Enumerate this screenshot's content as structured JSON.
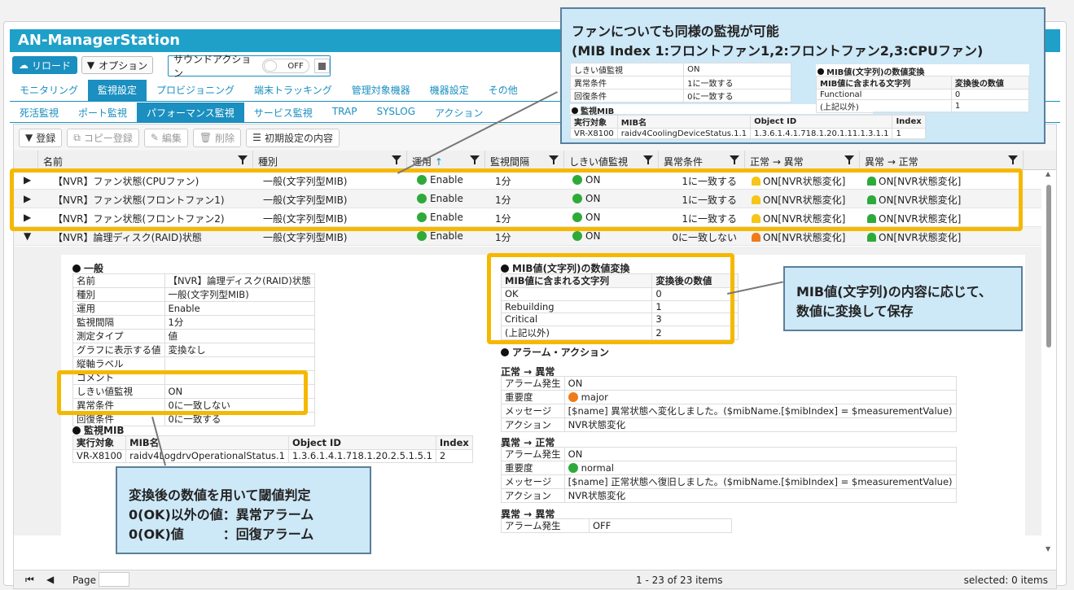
{
  "app": {
    "title": "AN-ManagerStation"
  },
  "toolbar": {
    "reload": "リロード",
    "option": "オプション",
    "sound_action": "サウンドアクション",
    "sound_state": "OFF"
  },
  "main_tabs": [
    "モニタリング",
    "監視設定",
    "プロビジョニング",
    "端末トラッキング",
    "管理対象機器",
    "機器設定",
    "その他"
  ],
  "sub_tabs": [
    "死活監視",
    "ポート監視",
    "パフォーマンス監視",
    "サービス監視",
    "TRAP",
    "SYSLOG",
    "アクション"
  ],
  "grid_toolbar": {
    "register": "登録",
    "copy_register": "コピー登録",
    "edit": "編集",
    "delete": "削除",
    "initial_settings": "初期設定の内容"
  },
  "columns": [
    "名前",
    "種別",
    "運用",
    "監視間隔",
    "しきい値監視",
    "異常条件",
    "正常 → 異常",
    "異常 → 正常"
  ],
  "rows": [
    {
      "name": "【NVR】ファン状態(CPUファン)",
      "type": "一般(文字列型MIB)",
      "status": "Enable",
      "interval": "1分",
      "threshold": "ON",
      "condition": "1に一致する",
      "to_abnormal": "ON[NVR状態変化]",
      "to_normal": "ON[NVR状態変化]"
    },
    {
      "name": "【NVR】ファン状態(フロントファン1)",
      "type": "一般(文字列型MIB)",
      "status": "Enable",
      "interval": "1分",
      "threshold": "ON",
      "condition": "1に一致する",
      "to_abnormal": "ON[NVR状態変化]",
      "to_normal": "ON[NVR状態変化]"
    },
    {
      "name": "【NVR】ファン状態(フロントファン2)",
      "type": "一般(文字列型MIB)",
      "status": "Enable",
      "interval": "1分",
      "threshold": "ON",
      "condition": "1に一致する",
      "to_abnormal": "ON[NVR状態変化]",
      "to_normal": "ON[NVR状態変化]"
    },
    {
      "name": "【NVR】論理ディスク(RAID)状態",
      "type": "一般(文字列型MIB)",
      "status": "Enable",
      "interval": "1分",
      "threshold": "ON",
      "condition": "0に一致しない",
      "to_abnormal": "ON[NVR状態変化]",
      "to_normal": "ON[NVR状態変化]"
    }
  ],
  "detail": {
    "general_title": "一般",
    "general": [
      [
        "名前",
        "【NVR】論理ディスク(RAID)状態"
      ],
      [
        "種別",
        "一般(文字列型MIB)"
      ],
      [
        "運用",
        "Enable"
      ],
      [
        "監視間隔",
        "1分"
      ],
      [
        "測定タイプ",
        "値"
      ],
      [
        "グラフに表示する値",
        "変換なし"
      ],
      [
        "縦軸ラベル",
        ""
      ],
      [
        "コメント",
        ""
      ],
      [
        "しきい値監視",
        "ON"
      ],
      [
        "異常条件",
        "0に一致しない"
      ],
      [
        "回復条件",
        "0に一致する"
      ]
    ],
    "mib_title": "監視MIB",
    "mib_headers": [
      "実行対象",
      "MIB名",
      "Object ID",
      "Index"
    ],
    "mib_row": [
      "VR-X8100",
      "raidv4LogdrvOperationalStatus.1",
      "1.3.6.1.4.1.718.1.20.2.5.1.5.1",
      "2"
    ],
    "conv_title": "MIB値(文字列)の数値変換",
    "conv_headers": [
      "MIB値に含まれる文字列",
      "変換後の数値"
    ],
    "conv_rows": [
      [
        "OK",
        "0"
      ],
      [
        "Rebuilding",
        "1"
      ],
      [
        "Critical",
        "3"
      ],
      [
        "(上記以外)",
        "2"
      ]
    ],
    "alarm_title": "アラーム・アクション",
    "n2a_title": "正常 → 異常",
    "n2a": {
      "alarm_label": "アラーム発生",
      "alarm": "ON",
      "severity_label": "重要度",
      "severity": "major",
      "message_label": "メッセージ",
      "message": "[$name] 異常状態へ変化しました。($mibName.[$mibIndex] = $measurementValue)",
      "action_label": "アクション",
      "action": "NVR状態変化"
    },
    "a2n_title": "異常 → 正常",
    "a2n": {
      "alarm_label": "アラーム発生",
      "alarm": "ON",
      "severity_label": "重要度",
      "severity": "normal",
      "message_label": "メッセージ",
      "message": "[$name] 正常状態へ復旧しました。($mibName.[$mibIndex] = $measurementValue)",
      "action_label": "アクション",
      "action": "NVR状態変化"
    },
    "a2a_title": "異常 → 異常",
    "a2a": {
      "alarm_label": "アラーム発生",
      "alarm": "OFF"
    }
  },
  "footer": {
    "page_label": "Page",
    "count": "1 - 23 of 23 items",
    "selected": "selected: 0 items"
  },
  "callouts": {
    "top_title_1": "ファンについても同様の監視が可能",
    "top_title_2": "(MIB Index 1:フロントファン1,2:フロントファン2,3:CPUファン)",
    "top_kv": [
      [
        "しきい値監視",
        "ON"
      ],
      [
        "異常条件",
        "1に一致する"
      ],
      [
        "回復条件",
        "0に一致する"
      ]
    ],
    "top_mib_title": "監視MIB",
    "top_mib_headers": [
      "実行対象",
      "MIB名",
      "Object ID",
      "Index"
    ],
    "top_mib_row": [
      "VR-X8100",
      "raidv4CoolingDeviceStatus.1.1",
      "1.3.6.1.4.1.718.1.20.1.11.1.3.1.1",
      "1"
    ],
    "top_conv_title": "MIB値(文字列)の数値変換",
    "top_conv_headers": [
      "MIB値に含まれる文字列",
      "変換後の数値"
    ],
    "top_conv_rows": [
      [
        "Functional",
        "0"
      ],
      [
        "(上記以外)",
        "1"
      ]
    ],
    "right_1": "MIB値(文字列)の内容に応じて、",
    "right_2": "数値に変換して保存",
    "bottom_1": "変換後の数値を用いて閾値判定",
    "bottom_2": "0(OK)以外の値：異常アラーム",
    "bottom_3": "0(OK)値　　　：回復アラーム"
  },
  "colors": {
    "brand": "#1fa0c8",
    "accent": "#1a8fc0",
    "highlight": "#f5b800",
    "callout_bg": "#cde8f7"
  }
}
